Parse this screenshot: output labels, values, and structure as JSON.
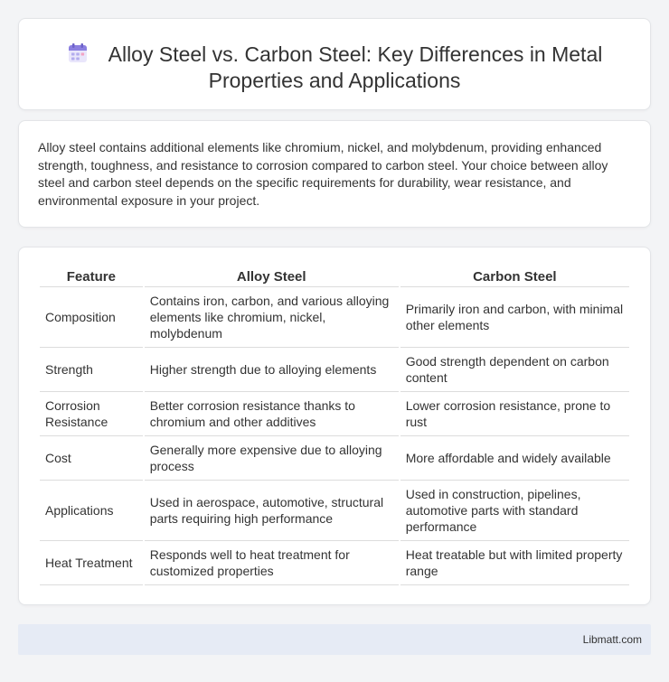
{
  "header": {
    "icon": "calendar-icon",
    "title": "Alloy Steel vs. Carbon Steel: Key Differences in Metal Properties and Applications"
  },
  "intro": {
    "text": "Alloy steel contains additional elements like chromium, nickel, and molybdenum, providing enhanced strength, toughness, and resistance to corrosion compared to carbon steel. Your choice between alloy steel and carbon steel depends on the specific requirements for durability, wear resistance, and environmental exposure in your project."
  },
  "table": {
    "headers": [
      "Feature",
      "Alloy Steel",
      "Carbon Steel"
    ],
    "rows": [
      [
        "Composition",
        "Contains iron, carbon, and various alloying elements like chromium, nickel, molybdenum",
        "Primarily iron and carbon, with minimal other elements"
      ],
      [
        "Strength",
        "Higher strength due to alloying elements",
        "Good strength dependent on carbon content"
      ],
      [
        "Corrosion Resistance",
        "Better corrosion resistance thanks to chromium and other additives",
        "Lower corrosion resistance, prone to rust"
      ],
      [
        "Cost",
        "Generally more expensive due to alloying process",
        "More affordable and widely available"
      ],
      [
        "Applications",
        "Used in aerospace, automotive, structural parts requiring high performance",
        "Used in construction, pipelines, automotive parts with standard performance"
      ],
      [
        "Heat Treatment",
        "Responds well to heat treatment for customized properties",
        "Heat treatable but with limited property range"
      ]
    ]
  },
  "footer": {
    "text": "Libmatt.com"
  },
  "colors": {
    "background": "#f3f4f6",
    "card": "#ffffff",
    "footer": "#e6ebf5",
    "icon_purple": "#8b7fe0",
    "icon_pink": "#f3a3c4"
  }
}
